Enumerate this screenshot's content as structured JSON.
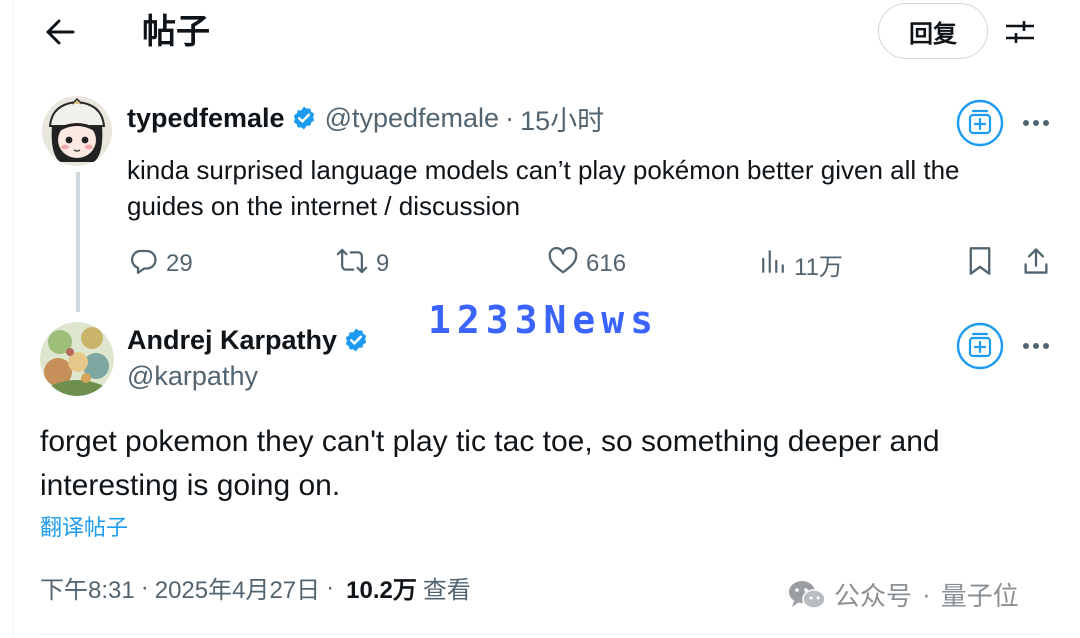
{
  "header": {
    "title": "帖子",
    "reply_label": "回复"
  },
  "tweet1": {
    "name": "typedfemale",
    "handle": "@typedfemale",
    "separator": "·",
    "time": "15小时",
    "text": "kinda surprised language models can’t play pokémon better given all the guides on the internet / discussion",
    "actions": {
      "replies": "29",
      "retweets": "9",
      "likes": "616",
      "views": "11万"
    }
  },
  "watermark": "1233News",
  "tweet2": {
    "name": "Andrej Karpathy",
    "handle": "@karpathy",
    "text": "forget pokemon they can't play tic tac toe, so something deeper and interesting is going on.",
    "translate": "翻译帖子",
    "meta": {
      "time": "下午8:31",
      "dot": "·",
      "date": "2025年4月27日",
      "views_count": "10.2万",
      "views_label": "查看"
    }
  },
  "credit": {
    "source": "公众号",
    "separator": "·",
    "account": "量子位"
  },
  "colors": {
    "verified": "#1d9bf0",
    "link": "#1d9bf0",
    "muted": "#536471",
    "watermark": "#3b64ff",
    "grok": "#1d9bf0"
  }
}
